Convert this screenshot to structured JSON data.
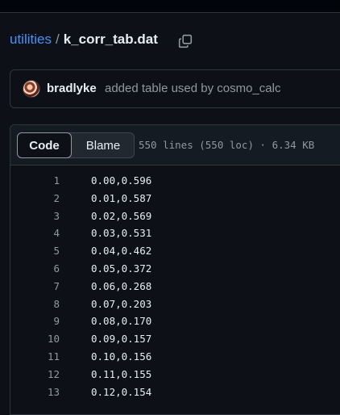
{
  "breadcrumb": {
    "repo": "utilities",
    "separator": "/",
    "file": "k_corr_tab.dat"
  },
  "icons": {
    "copy": "copy-icon"
  },
  "commit": {
    "author": "bradlyke",
    "message": "added table used by cosmo_calc"
  },
  "file_header": {
    "tabs": [
      {
        "label": "Code",
        "selected": true
      },
      {
        "label": "Blame",
        "selected": false
      }
    ],
    "meta": "550 lines (550 loc) · 6.34 KB"
  },
  "lines": [
    {
      "n": "1",
      "text": "0.00,0.596"
    },
    {
      "n": "2",
      "text": "0.01,0.587"
    },
    {
      "n": "3",
      "text": "0.02,0.569"
    },
    {
      "n": "4",
      "text": "0.03,0.531"
    },
    {
      "n": "5",
      "text": "0.04,0.462"
    },
    {
      "n": "6",
      "text": "0.05,0.372"
    },
    {
      "n": "7",
      "text": "0.06,0.268"
    },
    {
      "n": "8",
      "text": "0.07,0.203"
    },
    {
      "n": "9",
      "text": "0.08,0.170"
    },
    {
      "n": "10",
      "text": "0.09,0.157"
    },
    {
      "n": "11",
      "text": "0.10,0.156"
    },
    {
      "n": "12",
      "text": "0.11,0.155"
    },
    {
      "n": "13",
      "text": "0.12,0.154"
    }
  ],
  "colors": {
    "background": "#0d1117",
    "link": "#4493f8",
    "border": "#30363d",
    "muted": "#9198a1"
  }
}
